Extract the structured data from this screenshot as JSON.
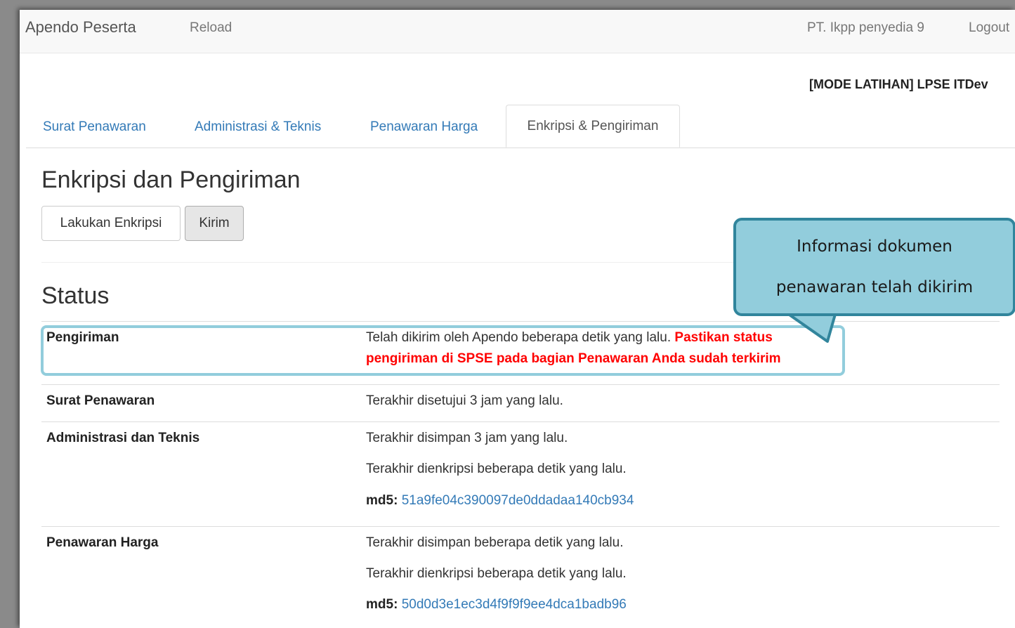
{
  "navbar": {
    "brand": "Apendo Peserta",
    "reload": "Reload",
    "user": "PT. Ikpp penyedia 9",
    "logout": "Logout"
  },
  "mode_label": "[MODE LATIHAN] LPSE ITDev",
  "tabs": [
    {
      "label": "Surat Penawaran"
    },
    {
      "label": "Administrasi & Teknis"
    },
    {
      "label": "Penawaran Harga"
    },
    {
      "label": "Enkripsi & Pengiriman"
    }
  ],
  "page_title": "Enkripsi dan Pengiriman",
  "buttons": {
    "encrypt": "Lakukan Enkripsi",
    "send": "Kirim"
  },
  "status": {
    "title": "Status",
    "rows": [
      {
        "label": "Pengiriman",
        "text": "Telah dikirim oleh Apendo beberapa detik yang lalu.",
        "warning_part1": "Pastikan status",
        "warning_part2": "pengiriman di SPSE pada bagian Penawaran Anda sudah terkirim"
      },
      {
        "label": "Surat Penawaran",
        "text": "Terakhir disetujui 3 jam yang lalu."
      },
      {
        "label": "Administrasi dan Teknis",
        "saved": "Terakhir disimpan 3 jam yang lalu.",
        "encrypted": "Terakhir dienkripsi beberapa detik yang lalu.",
        "md5_label": "md5:",
        "md5": "51a9fe04c390097de0ddadaa140cb934"
      },
      {
        "label": "Penawaran Harga",
        "saved": "Terakhir disimpan beberapa detik yang lalu.",
        "encrypted": "Terakhir dienkripsi beberapa detik yang lalu.",
        "md5_label": "md5:",
        "md5": "50d0d3e1ec3d4f9f9f9ee4dca1badb96"
      }
    ]
  },
  "callout": {
    "line1": "Informasi dokumen",
    "line2": "penawaran telah dikirim"
  },
  "colors": {
    "link": "#337ab7",
    "warning": "#ff0000",
    "callout_fill": "#92cddc",
    "callout_border": "#31859c"
  }
}
